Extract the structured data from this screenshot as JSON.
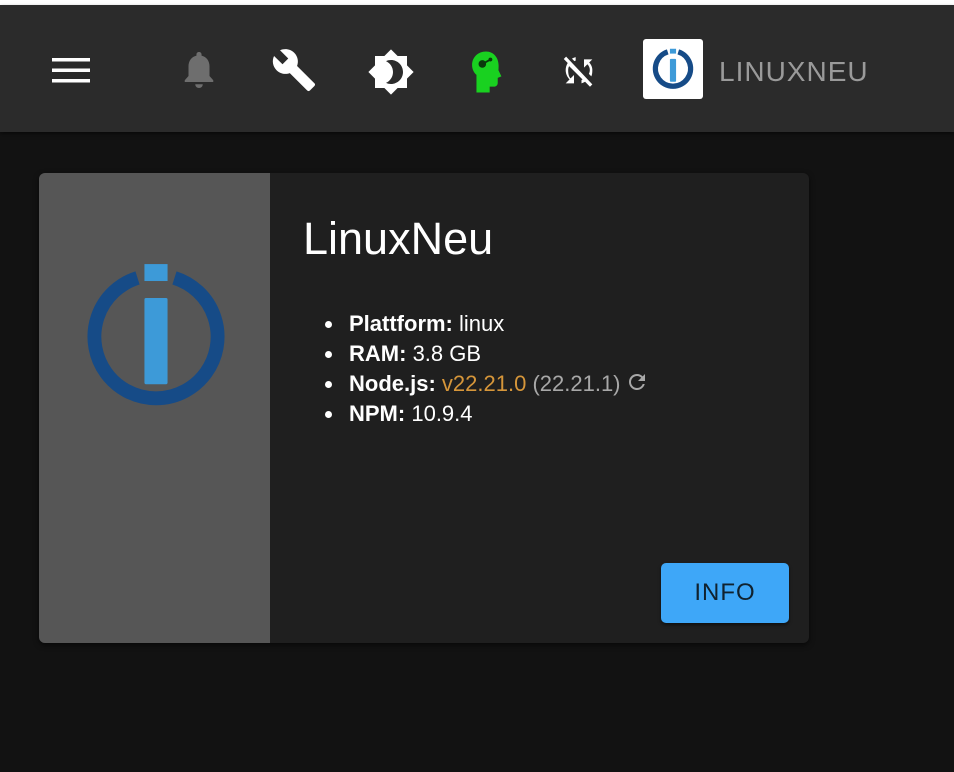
{
  "topbar": {
    "icons": {
      "menu": "hamburger-menu-icon",
      "notifications": "bell-icon",
      "settings": "wrench-icon",
      "theme": "brightness-icon",
      "expert_mode": "expert-head-icon",
      "sync": "sync-off-icon"
    },
    "host_name": "LINUXNEU"
  },
  "host_card": {
    "title": "LinuxNeu",
    "platform_label": "Plattform:",
    "platform_value": "linux",
    "ram_label": "RAM:",
    "ram_value": "3.8 GB",
    "node_label": "Node.js:",
    "node_current": "v22.21.0",
    "node_latest": "(22.21.1)",
    "npm_label": "NPM:",
    "npm_value": "10.9.4",
    "info_button": "INFO"
  },
  "colors": {
    "topbar_bg": "#2b2b2b",
    "page_bg": "#121212",
    "card_bg": "#1f1f1f",
    "card_media_bg": "#565656",
    "logo_dark_blue": "#164b87",
    "logo_light_blue": "#3d9ad8",
    "expert_green": "#19d120",
    "node_version_color": "#d6963a",
    "button_blue": "#3ea7f8"
  }
}
